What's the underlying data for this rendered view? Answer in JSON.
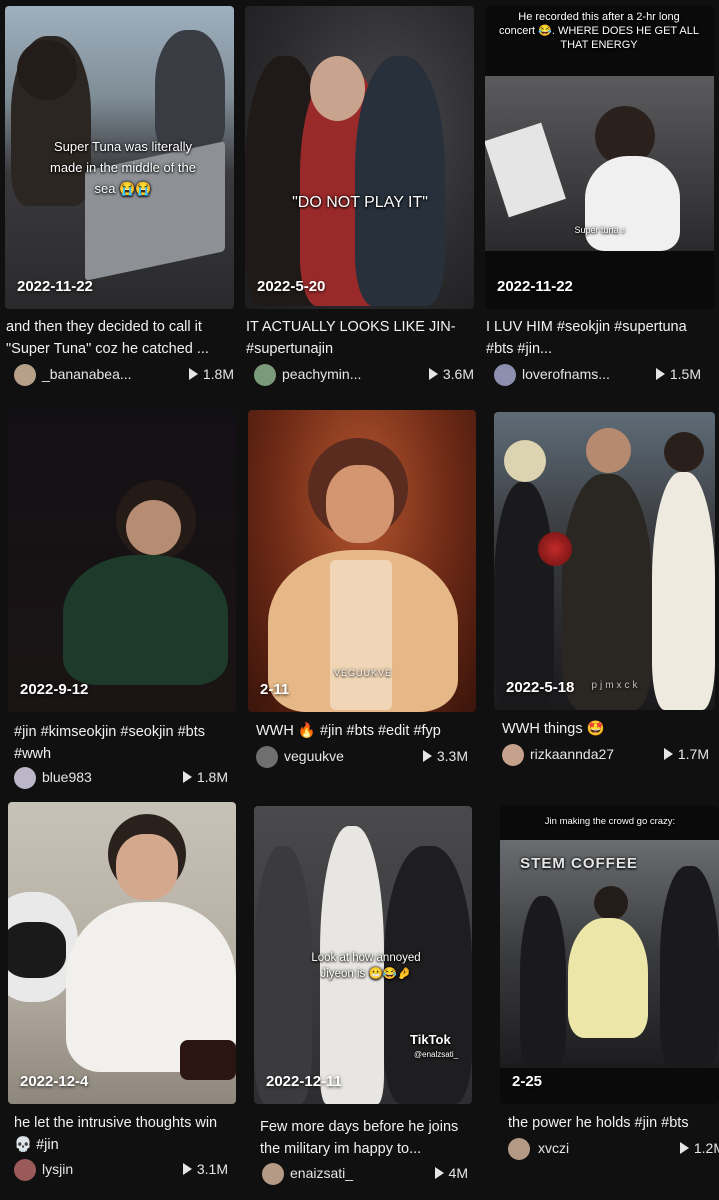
{
  "cards": [
    {
      "date": "2022-11-22",
      "overlay": "Super Tuna was literally made in the middle of the sea 😭😭",
      "caption": "and then they decided to call it \"Super Tuna\" coz he catched ...",
      "user": "_bananabea...",
      "views": "1.8M"
    },
    {
      "date": "2022-5-20",
      "overlay": "\"DO NOT PLAY IT\"",
      "caption": "IT ACTUALLY LOOKS LIKE JIN- #supertunajin",
      "user": "peachymin...",
      "views": "3.6M"
    },
    {
      "date": "2022-11-22",
      "overlay": "He recorded this after a 2-hr long concert 😂. WHERE DOES HE GET ALL THAT ENERGY",
      "sub": "Super tuna ♪",
      "caption": "I LUV HIM #seokjin #supertuna #bts #jin...",
      "user": "loverofnams...",
      "views": "1.5M"
    },
    {
      "date": "2022-9-12",
      "caption": "#jin #kimseokjin #seokjin #bts #wwh",
      "user": "blue983",
      "views": "1.8M"
    },
    {
      "date": "2-11",
      "watermark": "VEGUUKVE",
      "caption": "WWH 🔥 #jin #bts #edit #fyp",
      "user": "veguukve",
      "views": "3.3M"
    },
    {
      "date": "2022-5-18",
      "watermark": "pjmxck",
      "caption": "WWH things 🤩",
      "user": "rizkaannda27",
      "views": "1.7M"
    },
    {
      "date": "2022-12-4",
      "caption": "he let the intrusive thoughts win 💀 #jin",
      "user": "lysjin",
      "views": "3.1M"
    },
    {
      "date": "2022-12-11",
      "overlay": "Look at how annoyed Jiyeon is 😬😂🤌",
      "tiktok": "TikTok",
      "tiktok_user": "@enalzsati_",
      "caption": "Few more days before he joins the military im happy to...",
      "user": "enaizsati_",
      "views": "4M"
    },
    {
      "date": "2-25",
      "overlay": "Jin making the crowd go crazy:",
      "sign": "STEM COFFEE",
      "caption": "the power he holds #jin #bts",
      "user": "xvczi",
      "views": "1.2M"
    }
  ]
}
